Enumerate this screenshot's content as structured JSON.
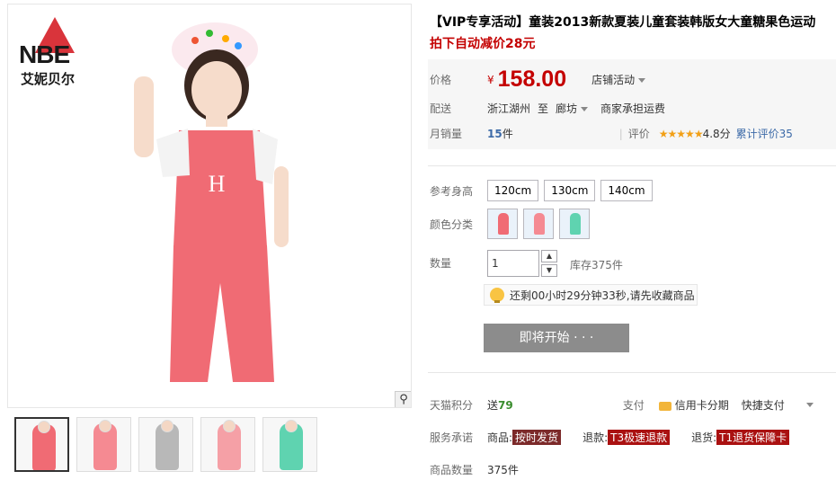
{
  "brand": {
    "logo_text": "NBE",
    "logo_sub": "艾妮贝尔"
  },
  "product": {
    "title": "【VIP专享活动】童装2013新款夏装儿童套装韩版女大童糖果色运动",
    "subtitle": "拍下自动减价28元"
  },
  "price": {
    "label": "价格",
    "currency": "¥",
    "value": "158.00",
    "shop_activity": "店铺活动"
  },
  "delivery": {
    "label": "配送",
    "from": "浙江湖州",
    "to_word": "至",
    "to": "廊坊",
    "shipping": "商家承担运费"
  },
  "sales": {
    "label": "月销量",
    "value": "15",
    "unit": "件",
    "rating_label": "评价",
    "stars": "★★★★★",
    "score": "4.8分",
    "reviews": "累计评价35"
  },
  "size": {
    "label": "参考身高",
    "options": [
      "120cm",
      "130cm",
      "140cm"
    ]
  },
  "color": {
    "label": "颜色分类",
    "options": [
      "pink",
      "pink",
      "green"
    ]
  },
  "quantity": {
    "label": "数量",
    "value": "1",
    "stock": "库存375件"
  },
  "notice": {
    "text": "还剩00小时29分钟33秒,请先收藏商品"
  },
  "action": {
    "start_label": "即将开始 · · ·"
  },
  "points": {
    "label": "天猫积分",
    "text": "送",
    "value": "79",
    "pay_label": "支付",
    "credit": "信用卡分期",
    "quick": "快捷支付"
  },
  "service": {
    "label": "服务承诺",
    "items": [
      {
        "prefix": "商品:",
        "tag": "按时发货"
      },
      {
        "prefix": "退款:",
        "tag": "T3极速退款"
      },
      {
        "prefix": "退货:",
        "tag": "T1退货保障卡"
      }
    ]
  },
  "count": {
    "label": "商品数量",
    "value": "375件"
  },
  "colors": {
    "accent": "#c40000",
    "pink": "#f06b74",
    "green": "#5fd3b0"
  }
}
